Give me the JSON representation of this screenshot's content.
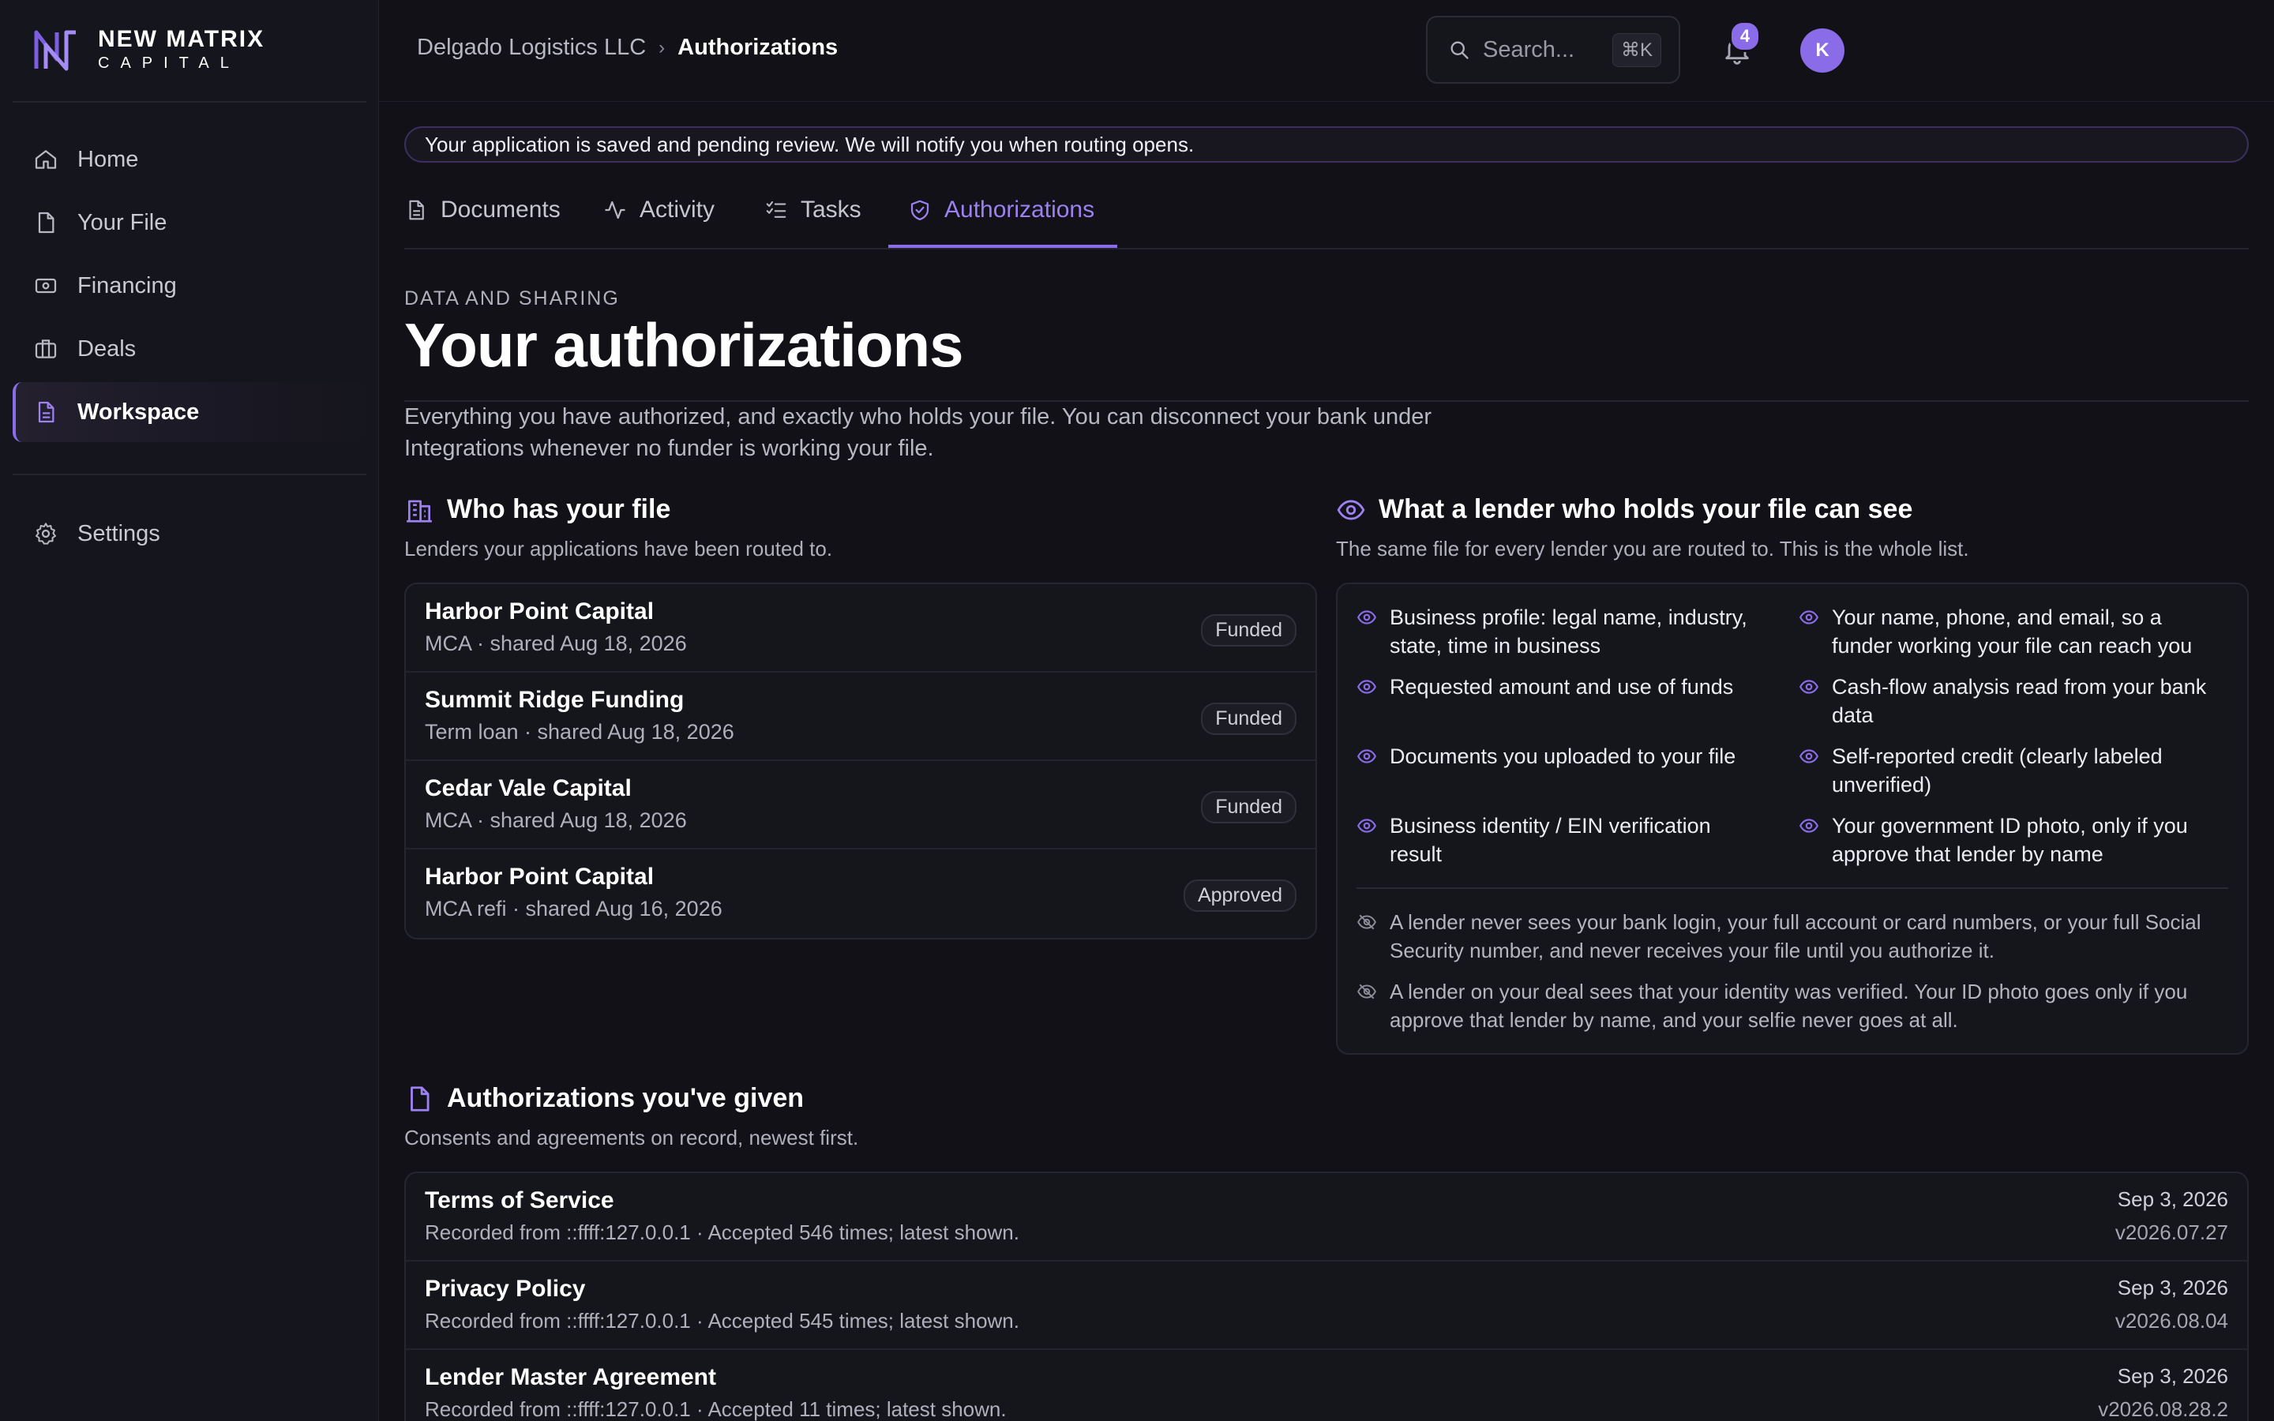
{
  "brand": {
    "name": "NEW MATRIX",
    "sub": "CAPITAL"
  },
  "sidebar": {
    "items": [
      {
        "label": "Home",
        "icon": "home-icon"
      },
      {
        "label": "Your File",
        "icon": "file-icon"
      },
      {
        "label": "Financing",
        "icon": "banknote-icon"
      },
      {
        "label": "Deals",
        "icon": "briefcase-icon"
      },
      {
        "label": "Workspace",
        "icon": "document-icon",
        "active": true
      }
    ],
    "settings": {
      "label": "Settings",
      "icon": "gear-icon"
    }
  },
  "header": {
    "breadcrumb": [
      "Delgado Logistics LLC",
      "Authorizations"
    ],
    "search_placeholder": "Search...",
    "search_shortcut": "⌘K",
    "notification_count": "4",
    "avatar_initial": "K"
  },
  "banner": "Your application is saved and pending review. We will notify you when routing opens.",
  "tabs": [
    {
      "label": "Documents",
      "icon": "document-icon"
    },
    {
      "label": "Activity",
      "icon": "activity-icon"
    },
    {
      "label": "Tasks",
      "icon": "checklist-icon"
    },
    {
      "label": "Authorizations",
      "icon": "shield-check-icon",
      "active": true
    }
  ],
  "page": {
    "eyebrow": "DATA AND SHARING",
    "title": "Your authorizations",
    "intro": "Everything you have authorized, and exactly who holds your file. You can disconnect your bank under Integrations whenever no funder is working your file."
  },
  "who_has_file": {
    "title": "Who has your file",
    "subtitle": "Lenders your applications have been routed to.",
    "lenders": [
      {
        "name": "Harbor Point Capital",
        "meta": "MCA · shared Aug 18, 2026",
        "status": "Funded"
      },
      {
        "name": "Summit Ridge Funding",
        "meta": "Term loan · shared Aug 18, 2026",
        "status": "Funded"
      },
      {
        "name": "Cedar Vale Capital",
        "meta": "MCA · shared Aug 18, 2026",
        "status": "Funded"
      },
      {
        "name": "Harbor Point Capital",
        "meta": "MCA refi · shared Aug 16, 2026",
        "status": "Approved"
      }
    ]
  },
  "lender_can_see": {
    "title": "What a lender who holds your file can see",
    "subtitle": "The same file for every lender you are routed to. This is the whole list.",
    "items_left": [
      "Business profile: legal name, industry, state, time in business",
      "Requested amount and use of funds",
      "Documents you uploaded to your file",
      "Business identity / EIN verification result"
    ],
    "items_right": [
      "Your name, phone, and email, so a funder working your file can reach you",
      "Cash-flow analysis read from your bank data",
      "Self-reported credit (clearly labeled unverified)",
      "Your government ID photo, only if you approve that lender by name"
    ],
    "never": [
      "A lender never sees your bank login, your full account or card numbers, or your full Social Security number, and never receives your file until you authorize it.",
      "A lender on your deal sees that your identity was verified. Your ID photo goes only if you approve that lender by name, and your selfie never goes at all."
    ]
  },
  "authorizations": {
    "title": "Authorizations you've given",
    "subtitle": "Consents and agreements on record, newest first.",
    "rows": [
      {
        "name": "Terms of Service",
        "meta": "Recorded from ::ffff:127.0.0.1 · Accepted 546 times; latest shown.",
        "date": "Sep 3, 2026",
        "version": "v2026.07.27"
      },
      {
        "name": "Privacy Policy",
        "meta": "Recorded from ::ffff:127.0.0.1 · Accepted 545 times; latest shown.",
        "date": "Sep 3, 2026",
        "version": "v2026.08.04"
      },
      {
        "name": "Lender Master Agreement",
        "meta": "Recorded from ::ffff:127.0.0.1 · Accepted 11 times; latest shown.",
        "date": "Sep 3, 2026",
        "version": "v2026.08.28.2"
      }
    ]
  },
  "colors": {
    "accent": "#8b6ce8",
    "background": "#111117",
    "sidebar": "#15151d"
  }
}
